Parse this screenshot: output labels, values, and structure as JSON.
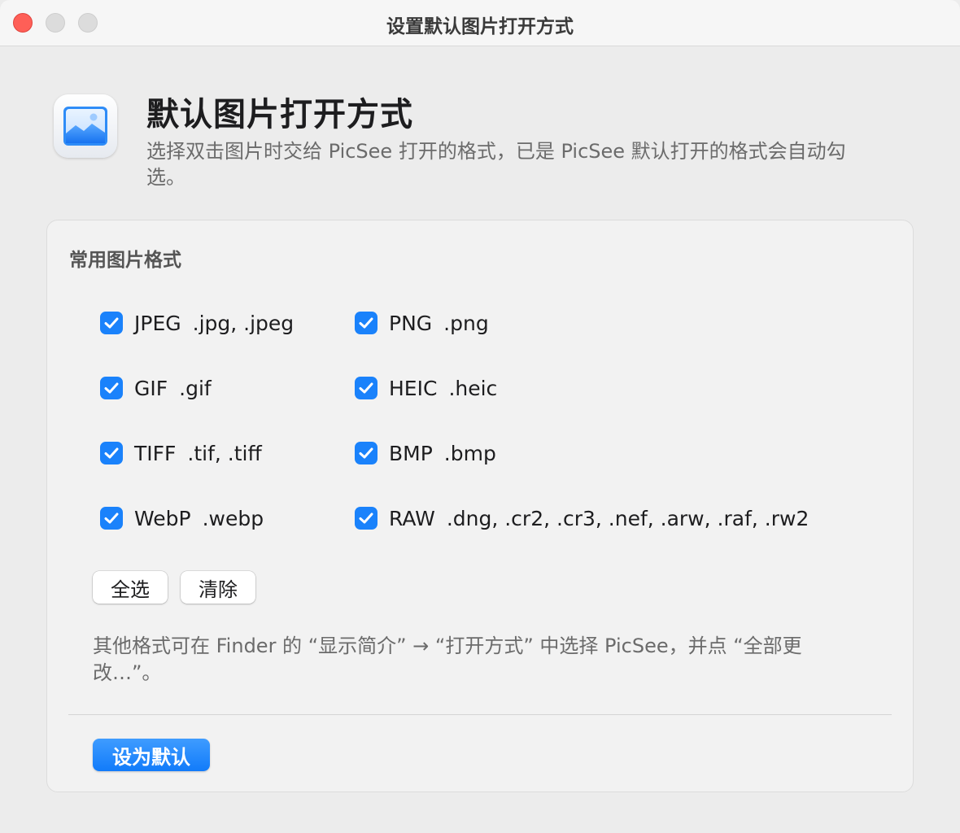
{
  "window": {
    "title": "设置默认图片打开方式"
  },
  "header": {
    "icon": "picture-app-icon",
    "title": "默认图片打开方式",
    "subtitle": "选择双击图片时交给 PicSee 打开的格式，已是 PicSee 默认打开的格式会自动勾选。"
  },
  "formats": {
    "section_title": "常用图片格式",
    "items": [
      {
        "name": "JPEG",
        "ext": ".jpg, .jpeg",
        "checked": true
      },
      {
        "name": "PNG",
        "ext": ".png",
        "checked": true
      },
      {
        "name": "GIF",
        "ext": ".gif",
        "checked": true
      },
      {
        "name": "HEIC",
        "ext": ".heic",
        "checked": true
      },
      {
        "name": "TIFF",
        "ext": ".tif, .tiff",
        "checked": true
      },
      {
        "name": "BMP",
        "ext": ".bmp",
        "checked": true
      },
      {
        "name": "WebP",
        "ext": ".webp",
        "checked": true
      },
      {
        "name": "RAW",
        "ext": ".dng, .cr2, .cr3, .nef, .arw, .raf, .rw2",
        "checked": true
      }
    ]
  },
  "actions": {
    "select_all": "全选",
    "clear": "清除",
    "set_default": "设为默认"
  },
  "note": "其他格式可在 Finder 的 “显示简介” → “打开方式” 中选择 PicSee，并点 “全部更改…”。",
  "colors": {
    "accent": "#1a82fb",
    "close": "#fe5f57"
  }
}
